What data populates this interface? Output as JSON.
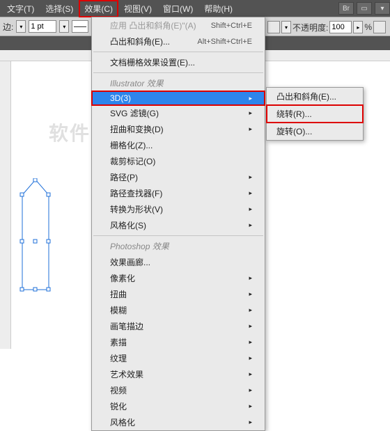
{
  "menubar": {
    "items": [
      "文字(T)",
      "选择(S)",
      "效果(C)",
      "视图(V)",
      "窗口(W)",
      "帮助(H)"
    ],
    "highlighted_index": 2
  },
  "toolbar_right": {
    "br": "Br"
  },
  "toolbar2": {
    "stroke_label": "边:",
    "stroke_value": "1 pt",
    "opacity_label": "不透明度:",
    "opacity_value": "100",
    "percent": "%"
  },
  "watermark": "软件自学网",
  "menu": {
    "apply": {
      "label": "应用 凸出和斜角(E)\"(A)",
      "shortcut": "Shift+Ctrl+E"
    },
    "extrude": {
      "label": "凸出和斜角(E)...",
      "shortcut": "Alt+Shift+Ctrl+E"
    },
    "doc_raster": "文档栅格效果设置(E)...",
    "header_ai": "Illustrator 效果",
    "three_d": "3D(3)",
    "svg": "SVG 滤镜(G)",
    "transform": "扭曲和变换(D)",
    "rasterize": "栅格化(Z)...",
    "crop": "裁剪标记(O)",
    "path": "路径(P)",
    "pathfinder": "路径查找器(F)",
    "convert": "转换为形状(V)",
    "stylize_ai": "风格化(S)",
    "header_ps": "Photoshop 效果",
    "gallery": "效果画廊...",
    "pixelate": "像素化",
    "distort": "扭曲",
    "blur": "模糊",
    "brush": "画笔描边",
    "sketch": "素描",
    "texture": "纹理",
    "artistic": "艺术效果",
    "video": "视频",
    "sharpen": "锐化",
    "stylize_ps": "风格化"
  },
  "submenu": {
    "extrude": "凸出和斜角(E)...",
    "revolve": "绕转(R)...",
    "rotate": "旋转(O)..."
  },
  "arrow": "▸"
}
